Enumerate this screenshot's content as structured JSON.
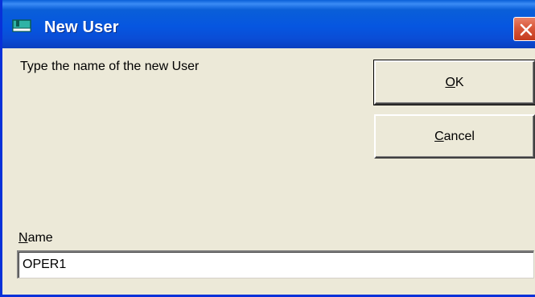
{
  "window": {
    "title": "New User",
    "icon": "user-window-icon",
    "close_icon": "close-icon"
  },
  "dialog": {
    "prompt": "Type the name of the new User",
    "ok_button": {
      "mnemonic": "O",
      "rest": "K"
    },
    "cancel_button": {
      "mnemonic": "C",
      "rest": "ancel"
    },
    "name_label": {
      "mnemonic": "N",
      "rest": "ame"
    },
    "name_value": "OPER1"
  },
  "colors": {
    "titlebar": "#0a5fd8",
    "window_bg": "#ece9d8",
    "close_button": "#d8573a"
  }
}
